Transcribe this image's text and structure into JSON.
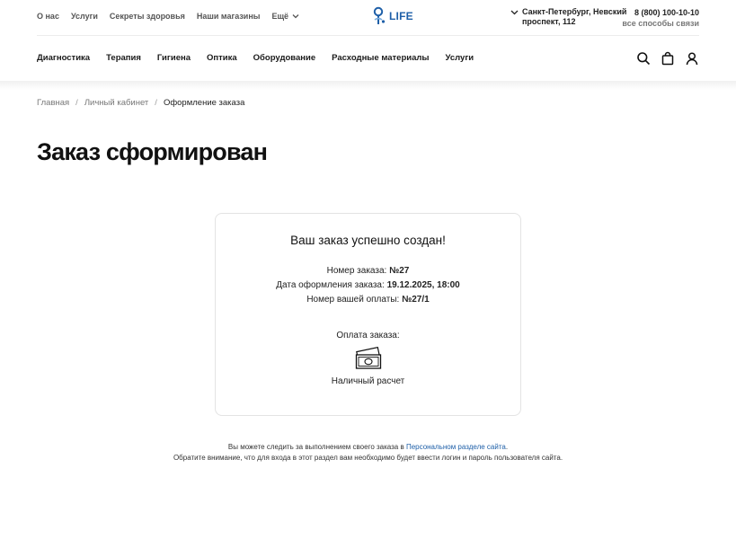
{
  "header": {
    "top_links": [
      "О нас",
      "Услуги",
      "Секреты здоровья",
      "Наши магазины"
    ],
    "more_label": "Ещё",
    "logo_text": "LIFE",
    "city_line1": "Санкт-Петербург, Невский",
    "city_line2": "проспект, 112",
    "phone": "8 (800) 100-10-10",
    "contacts_link": "все способы связи"
  },
  "nav": {
    "items": [
      "Диагностика",
      "Терапия",
      "Гигиена",
      "Оптика",
      "Оборудование",
      "Расходные материалы",
      "Услуги"
    ],
    "icons": [
      "search-icon",
      "cart-icon",
      "user-icon"
    ]
  },
  "breadcrumb": [
    "Главная",
    "Личный кабинет",
    "Оформление заказа"
  ],
  "page_title": "Заказ сформирован",
  "order": {
    "title": "Ваш заказ успешно создан!",
    "number_label": "Номер заказа: ",
    "number_value": "№27",
    "date_label": "Дата оформления заказа: ",
    "date_value": "19.12.2025, 18:00",
    "payment_no_label": "Номер вашей оплаты: ",
    "payment_no_value": "№27/1",
    "payment_label": "Оплата заказа:",
    "payment_icon": "cash-icon",
    "payment_method": "Наличный расчет"
  },
  "note": {
    "line1_prefix": "Вы можете следить за выполнением своего заказа в ",
    "line1_link": "Персональном разделе сайта",
    "line1_suffix": ".",
    "line2": "Обратите внимание, что для входа в этот раздел вам необходимо будет ввести логин и пароль пользователя сайта."
  },
  "colors": {
    "accent": "#1e5fa8"
  }
}
